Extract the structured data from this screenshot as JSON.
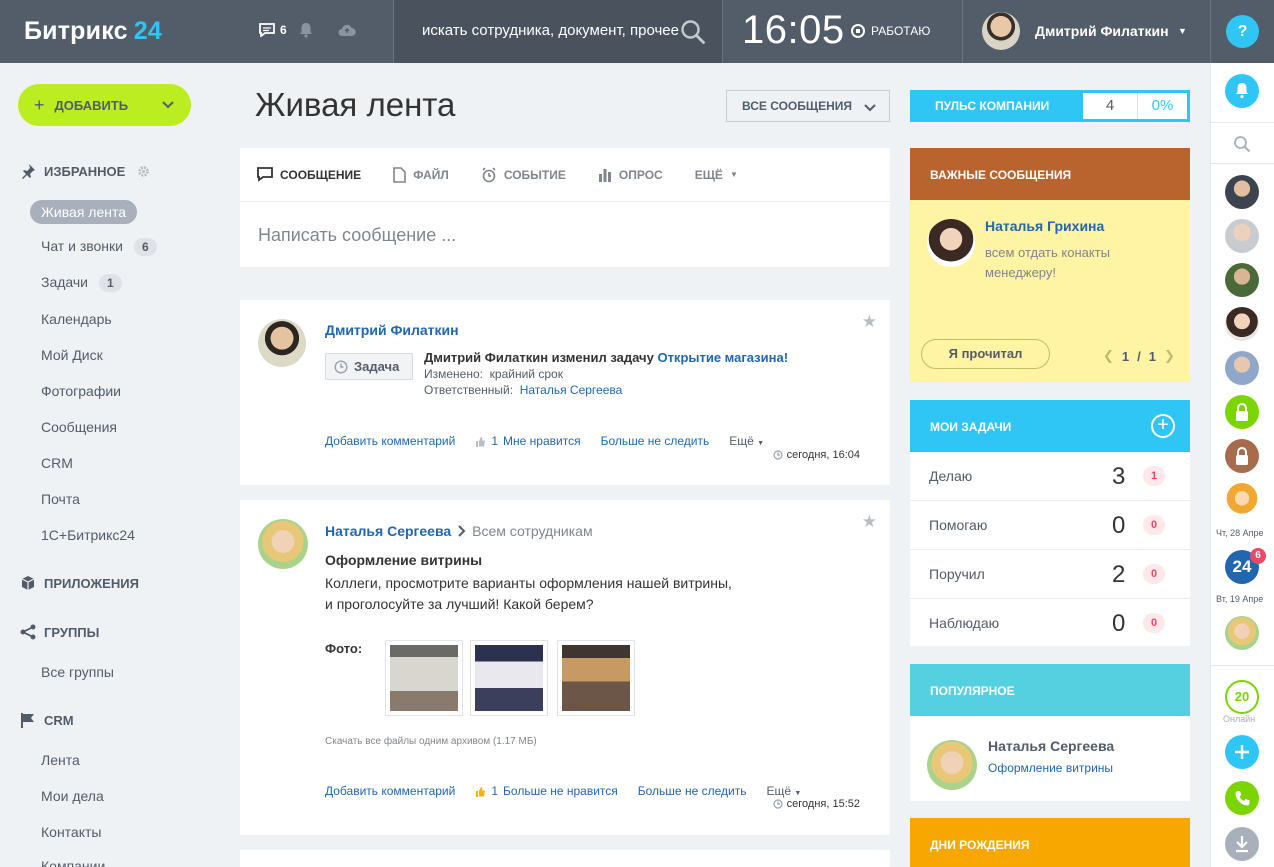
{
  "topbar": {
    "logo_text": "Битрикс",
    "logo_num": "24",
    "chat_count": "6",
    "search_placeholder": "искать сотрудника, документ, прочее",
    "time": "16:05",
    "status": "РАБОТАЮ",
    "user_name": "Дмитрий Филаткин",
    "help": "?"
  },
  "sidebar": {
    "add_label": "ДОБАВИТЬ",
    "favorites_title": "ИЗБРАННОЕ",
    "items": [
      {
        "label": "Живая лента"
      },
      {
        "label": "Чат и звонки",
        "count": "6"
      },
      {
        "label": "Задачи",
        "count": "1"
      },
      {
        "label": "Календарь"
      },
      {
        "label": "Мой Диск"
      },
      {
        "label": "Фотографии"
      },
      {
        "label": "Сообщения"
      },
      {
        "label": "CRM"
      },
      {
        "label": "Почта"
      },
      {
        "label": "1С+Битрикс24"
      }
    ],
    "apps_title": "ПРИЛОЖЕНИЯ",
    "groups_title": "ГРУППЫ",
    "groups_items": [
      "Все группы"
    ],
    "crm_title": "CRM",
    "crm_items": [
      "Лента",
      "Мои дела",
      "Контакты",
      "Компании"
    ]
  },
  "main": {
    "title": "Живая лента",
    "filter_label": "ВСЕ СООБЩЕНИЯ",
    "composer": {
      "tabs": [
        "СООБЩЕНИЕ",
        "ФАЙЛ",
        "СОБЫТИЕ",
        "ОПРОС",
        "ЕЩЁ"
      ],
      "placeholder": "Написать сообщение ..."
    },
    "post1": {
      "author": "Дмитрий Филаткин",
      "tag": "Задача",
      "headline_prefix": "Дмитрий Филаткин изменил задачу",
      "headline_link": "Открытие магазина!",
      "changed_label": "Изменено:",
      "changed_value": "крайний срок",
      "responsible_label": "Ответственный:",
      "responsible_value": "Наталья Сергеева",
      "add_comment": "Добавить комментарий",
      "likes": "1",
      "like_label": "Мне нравится",
      "unfollow": "Больше не следить",
      "more": "Ещё",
      "time": "сегодня, 16:04"
    },
    "post2": {
      "author": "Наталья Сергеева",
      "audience": "Всем сотрудникам",
      "title": "Оформление витрины",
      "text_line1": "Коллеги, просмотрите варианты оформления нашей витрины,",
      "text_line2": "и проголосуйте за лучший! Какой берем?",
      "photo_label": "Фото:",
      "download": "Скачать все файлы одним архивом (1.17 МБ)",
      "add_comment": "Добавить комментарий",
      "likes": "1",
      "like_label": "Больше не нравится",
      "unfollow": "Больше не следить",
      "more": "Ещё",
      "time": "сегодня, 15:52"
    }
  },
  "right": {
    "pulse_label": "ПУЛЬС КОМПАНИИ",
    "pulse_value": "4",
    "pulse_percent": "0%",
    "important_title": "ВАЖНЫЕ СООБЩЕНИЯ",
    "important_author": "Наталья Грихина",
    "important_text": "всем отдать конакты менеджеру!",
    "important_read": "Я прочитал",
    "important_page": "1",
    "important_sep": "/",
    "important_total": "1",
    "tasks_title": "МОИ ЗАДАЧИ",
    "tasks": [
      {
        "label": "Делаю",
        "count": "3",
        "badge": "1"
      },
      {
        "label": "Помогаю",
        "count": "0",
        "badge": "0"
      },
      {
        "label": "Поручил",
        "count": "2",
        "badge": "0"
      },
      {
        "label": "Наблюдаю",
        "count": "0",
        "badge": "0"
      }
    ],
    "popular_title": "ПОПУЛЯРНОЕ",
    "popular_author": "Наталья Сергеева",
    "popular_link": "Оформление витрины",
    "birthdays_title": "ДНИ РОЖДЕНИЯ"
  },
  "strip": {
    "date1": "Чт, 28 Апре",
    "badge24": "6",
    "label24": "24",
    "date2": "Вт, 19 Апре",
    "online_count": "20",
    "online_label": "Онлайн"
  },
  "colors": {
    "topbar": "#535c69",
    "accent_blue": "#2fc6f6",
    "add_green": "#bbed21",
    "important_header": "#b9632f",
    "important_bg": "#fff3a4",
    "popular": "#55d0e0",
    "birthdays": "#f7a700"
  }
}
